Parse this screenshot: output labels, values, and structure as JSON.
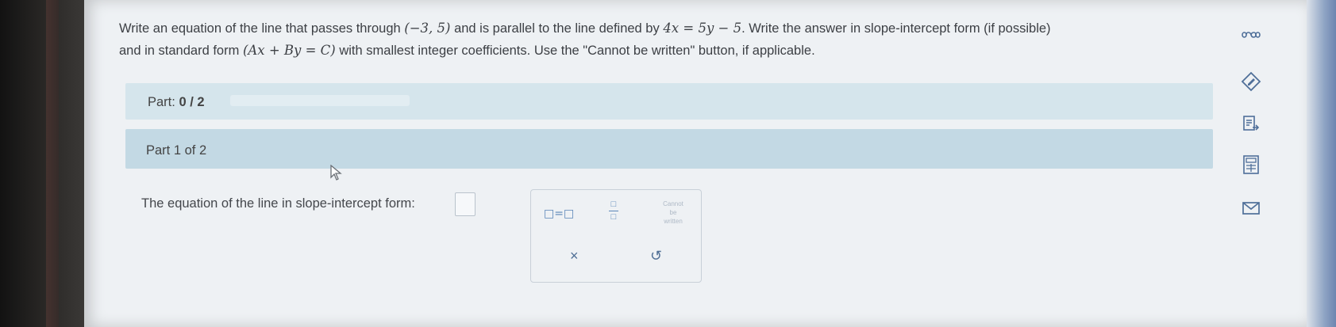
{
  "question": {
    "intro": "Write an equation of the line that passes through",
    "point": "(−3, 5)",
    "mid": "and is parallel to the line defined by",
    "line_eq": "4x = 5y − 5",
    "rest": ". Write the answer in slope-intercept form (if possible)",
    "line2_start": "and in standard form",
    "std_form": "(Ax + By = C)",
    "line2_end": "with smallest integer coefficients. Use the \"Cannot be written\" button, if applicable."
  },
  "part_progress": {
    "label_prefix": "Part:",
    "value": "0 / 2",
    "completed": 0,
    "total": 2
  },
  "sub_part": {
    "label": "Part 1 of 2"
  },
  "answer": {
    "prompt": "The equation of the line in slope-intercept form:",
    "value": ""
  },
  "palette": {
    "equation_button": "□=□",
    "fraction_top": "□",
    "fraction_bottom": "□",
    "cannot_line1": "Cannot",
    "cannot_line2": "be",
    "cannot_line3": "written",
    "clear_button": "×",
    "undo_button": "↺"
  },
  "sidebar_icons": [
    "infinity-icon",
    "pencil-diamond-icon",
    "document-arrow-icon",
    "calculator-icon",
    "mail-icon"
  ],
  "colors": {
    "accent": "#5a86b8",
    "band_light": "#d5e5ec",
    "band_dark": "#c3d9e4",
    "text": "#3c3f44"
  }
}
